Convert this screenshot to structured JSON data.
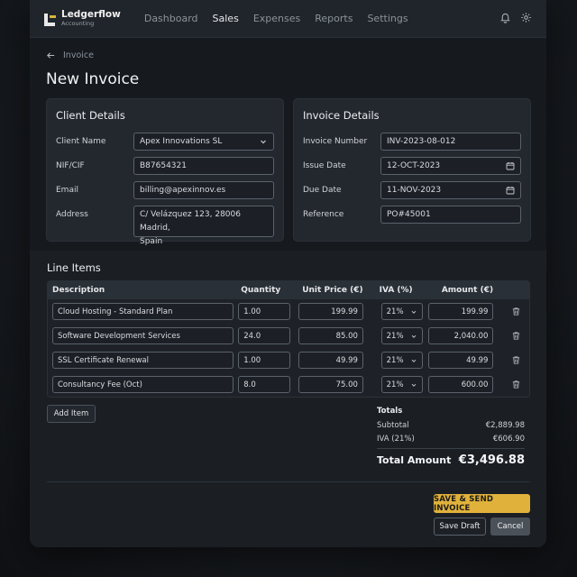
{
  "app": {
    "brand": "Ledgerflow",
    "brand_sub": "Accounting"
  },
  "nav": [
    "Dashboard",
    "Sales",
    "Expenses",
    "Reports",
    "Settings"
  ],
  "nav_active": "Sales",
  "breadcrumb": "Invoice",
  "page_title": "New Invoice",
  "client": {
    "title": "Client Details",
    "name_label": "Client Name",
    "name_value": "Apex Innovations SL",
    "nif_label": "NIF/CIF",
    "nif_value": "B87654321",
    "email_label": "Email",
    "email_value": "billing@apexinnov.es",
    "address_label": "Address",
    "address_line1": "C/ Velázquez 123, 28006 Madrid,",
    "address_line2": "Spain"
  },
  "invoice": {
    "title": "Invoice Details",
    "number_label": "Invoice Number",
    "number_value": "INV-2023-08-012",
    "issue_label": "Issue Date",
    "issue_value": "12-OCT-2023",
    "due_label": "Due Date",
    "due_value": "11-NOV-2023",
    "ref_label": "Reference",
    "ref_value": "PO#45001"
  },
  "line_items": {
    "title": "Line Items",
    "headers": {
      "desc": "Description",
      "qty": "Quantity",
      "price": "Unit Price (€)",
      "iva": "IVA (%)",
      "amount": "Amount (€)"
    },
    "rows": [
      {
        "desc": "Cloud Hosting - Standard Plan",
        "qty": "1.00",
        "price": "199.99",
        "iva": "21%",
        "amount": "199.99"
      },
      {
        "desc": "Software Development Services",
        "qty": "24.0",
        "price": "85.00",
        "iva": "21%",
        "amount": "2,040.00"
      },
      {
        "desc": "SSL Certificate Renewal",
        "qty": "1.00",
        "price": "49.99",
        "iva": "21%",
        "amount": "49.99"
      },
      {
        "desc": "Consultancy Fee (Oct)",
        "qty": "8.0",
        "price": "75.00",
        "iva": "21%",
        "amount": "600.00"
      }
    ],
    "add_label": "Add Item"
  },
  "totals": {
    "title": "Totals",
    "subtotal_label": "Subtotal",
    "subtotal_value": "€2,889.98",
    "iva_label": "IVA (21%)",
    "iva_value": "€606.90",
    "total_label": "Total Amount",
    "total_value": "€3,496.88"
  },
  "actions": {
    "primary": "SAVE & SEND INVOICE",
    "draft": "Save Draft",
    "cancel": "Cancel"
  },
  "colors": {
    "accent": "#e0b23c",
    "bg": "#1b1f24",
    "panel": "#23282f"
  },
  "icons": [
    "bell-icon",
    "gear-icon",
    "back-arrow-icon",
    "chevron-down-icon",
    "calendar-icon",
    "trash-icon"
  ]
}
